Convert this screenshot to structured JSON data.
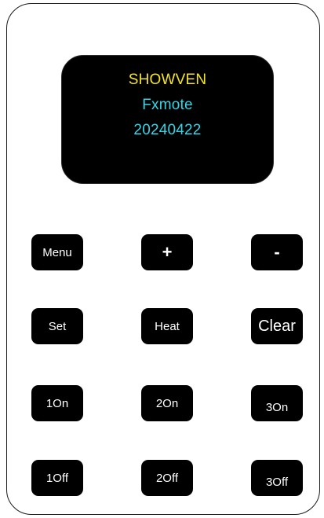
{
  "display": {
    "line1": "SHOWVEN",
    "line2": "Fxmote",
    "line3": "20240422"
  },
  "buttons": {
    "menu": "Menu",
    "plus": "+",
    "minus": "-",
    "set": "Set",
    "heat": "Heat",
    "clear": "Clear",
    "on1": "1On",
    "on2": "2On",
    "on3": "3On",
    "off1": "1Off",
    "off2": "2Off",
    "off3": "3Off"
  },
  "colors": {
    "body_border": "#1a1a1a",
    "screen_background": "#000000",
    "brand_text": "#f5e51b",
    "info_text": "#2fd7e8",
    "button_background": "#000000",
    "button_text": "#ffffff"
  }
}
